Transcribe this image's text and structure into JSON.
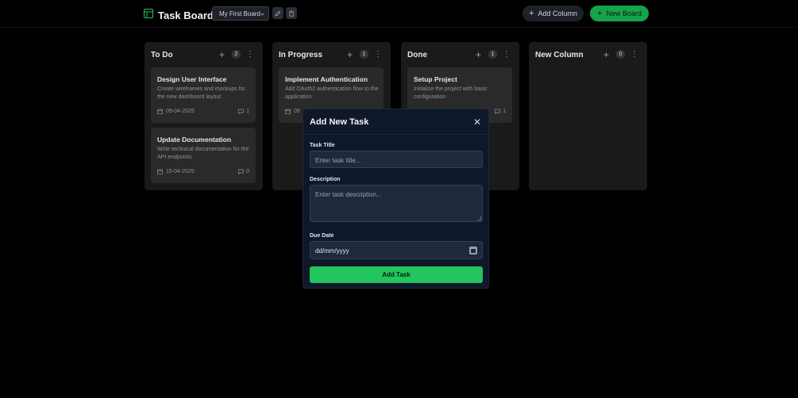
{
  "header": {
    "title": "Task Board",
    "board_select_value": "My First Board",
    "add_column_label": "Add Column",
    "new_board_label": "New Board"
  },
  "columns": [
    {
      "title": "To Do",
      "count": "2",
      "cards": [
        {
          "title": "Design User Interface",
          "description": "Create wireframes and mockups for the new dashboard layout",
          "date": "09-04-2025",
          "comments": "1"
        },
        {
          "title": "Update Documentation",
          "description": "Write technical documentation for the API endpoints",
          "date": "15-04-2025",
          "comments": "0"
        }
      ]
    },
    {
      "title": "In Progress",
      "count": "1",
      "cards": [
        {
          "title": "Implement Authentication",
          "description": "Add OAuth2 authentication flow to the application",
          "date": "09",
          "comments": ""
        }
      ]
    },
    {
      "title": "Done",
      "count": "1",
      "cards": [
        {
          "title": "Setup Project",
          "description": "Initialize the project with basic configuration",
          "date": "",
          "comments": "1"
        }
      ]
    },
    {
      "title": "New Column",
      "count": "0",
      "cards": []
    }
  ],
  "modal": {
    "title": "Add New Task",
    "close_glyph": "✕",
    "task_title_label": "Task Title",
    "task_title_placeholder": "Enter task title...",
    "description_label": "Description",
    "description_placeholder": "Enter task description...",
    "due_date_label": "Due Date",
    "due_date_value": "dd/mm/yyyy",
    "submit_label": "Add Task"
  },
  "colors": {
    "accent": "#22c55e",
    "background": "#000000",
    "column_bg": "#1a1a1a",
    "card_bg": "#2a2a2a",
    "modal_bg": "#0f172a"
  }
}
